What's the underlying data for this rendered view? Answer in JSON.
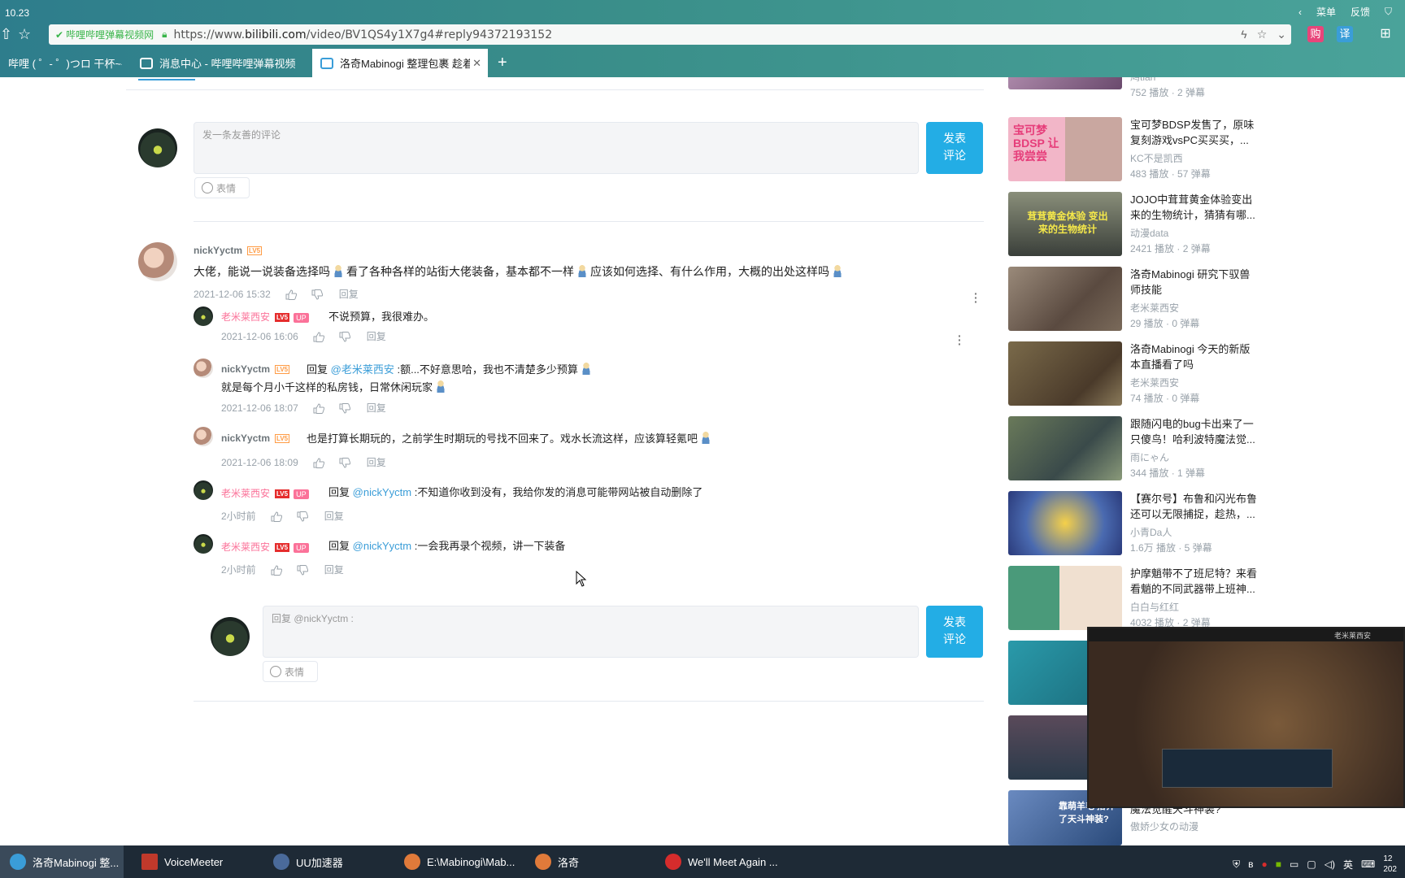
{
  "browser": {
    "version": "10.23",
    "menu": [
      "菜单",
      "反馈"
    ],
    "secure_label": "哔哩哔哩弹幕视频网",
    "url_prefix": "https://www.",
    "url_domain": "bilibili.com",
    "url_path": "/video/BV1QS4y1X7g4#reply94372193152",
    "ext_buy": "购",
    "ext_translate": "译",
    "tabs": [
      {
        "label": "哔哩 ( ゜- ゜)つロ 干杯~-"
      },
      {
        "label": "消息中心 - 哔哩哔哩弹幕视频"
      },
      {
        "label": "洛奇Mabinogi 整理包裹 趁着",
        "active": true
      }
    ]
  },
  "comment_box": {
    "placeholder": "发一条友善的评论",
    "send": "发表评论",
    "send_line1": "发表",
    "send_line2": "评论",
    "emoji": "表情"
  },
  "reply_box": {
    "placeholder": "回复 @nickYyctm :",
    "send_line1": "发表",
    "send_line2": "评论",
    "emoji": "表情"
  },
  "labels": {
    "reply": "回复",
    "up": "UP",
    "lv5": "LV5",
    "reply_prefix": "回复"
  },
  "comments": {
    "root": {
      "user": "nickYyctm",
      "text": "大佬，能说一说装备选择吗",
      "text2": "看了各种各样的站街大佬装备，基本都不一样",
      "text3": "应该如何选择、有什么作用，大概的出处这样吗",
      "time": "2021-12-06 15:32"
    },
    "replies": [
      {
        "user": "老米莱西安",
        "text": "不说预算，我很难办。",
        "time": "2021-12-06 16:06"
      },
      {
        "user": "nickYyctm",
        "at": "@老米莱西安",
        "text": ":额...不好意思哈，我也不清楚多少预算",
        "text2": "就是每个月小千这样的私房钱，日常休闲玩家",
        "time": "2021-12-06 18:07"
      },
      {
        "user": "nickYyctm",
        "text": "也是打算长期玩的，之前学生时期玩的号找不回来了。戏水长流这样，应该算轻氪吧",
        "time": "2021-12-06 18:09"
      },
      {
        "user": "老米莱西安",
        "at": "@nickYyctm",
        "text": ":不知道你收到没有，我给你发的消息可能带网站被自动删除了",
        "time": "2小时前"
      },
      {
        "user": "老米莱西安",
        "at": "@nickYyctm",
        "text": ":一会我再录个视频，讲一下装备",
        "time": "2小时前"
      }
    ]
  },
  "recommendations": [
    {
      "title1": "",
      "title2": "",
      "author": "鸠tian",
      "stats": "752 播放 · 2 弹幕"
    },
    {
      "title1": "宝可梦BDSP发售了，原味",
      "title2": "复刻游戏vsPC买买买，...",
      "author": "KC不是凯西",
      "stats": "483 播放 · 57 弹幕",
      "thumb_text": "宝可梦 BDSP 让我尝尝"
    },
    {
      "title1": "JOJO中茸茸黄金体验变出",
      "title2": "来的生物统计，猜猜有哪...",
      "author": "动漫data",
      "stats": "2421 播放 · 2 弹幕",
      "thumb_text": "茸茸黄金体验 变出来的生物统计"
    },
    {
      "title1": "洛奇Mabinogi 研究下驭兽",
      "title2": "师技能",
      "author": "老米莱西安",
      "stats": "29 播放 · 0 弹幕"
    },
    {
      "title1": "洛奇Mabinogi 今天的新版",
      "title2": "本直播看了吗",
      "author": "老米莱西安",
      "stats": "74 播放 · 0 弹幕"
    },
    {
      "title1": "跟随闪电的bug卡出来了一",
      "title2": "只傻鸟！哈利波特魔法觉...",
      "author": "雨にゃん",
      "stats": "344 播放 · 1 弹幕"
    },
    {
      "title1": "【赛尔号】布鲁和闪光布鲁",
      "title2": "还可以无限捕捉，趁热，...",
      "author": "小青Da人",
      "stats": "1.6万 播放 · 5 弹幕"
    },
    {
      "title1": "护摩魈带不了班尼特？来看",
      "title2": "看魈的不同武器带上班神...",
      "author": "白白与红红",
      "stats": "4032 播放 · 2 弹幕"
    },
    {
      "title1": "",
      "title2": "",
      "author": "",
      "stats": ""
    },
    {
      "title1": "",
      "title2": "",
      "author": "",
      "stats": ""
    },
    {
      "title1": "",
      "title2": "魔法觉醒天斗神装?",
      "author": "傲娇少女の动漫",
      "stats": "",
      "thumb_text": "靠萌羊毛 搭齐了天斗神装?"
    }
  ],
  "pip": {
    "channel": "老米莱西安"
  },
  "taskbar": [
    {
      "label": "洛奇Mabinogi 整...",
      "active": true
    },
    {
      "label": "VoiceMeeter"
    },
    {
      "label": "UU加速器"
    },
    {
      "label": "E:\\Mabinogi\\Mab..."
    },
    {
      "label": "洛奇"
    },
    {
      "label": "We'll Meet Again ..."
    }
  ],
  "tray": {
    "ime": "英",
    "time": "12",
    "date": "202"
  },
  "colors": {
    "accent": "#23ade5",
    "up_pink": "#fb7299",
    "link": "#3a9dd8"
  }
}
